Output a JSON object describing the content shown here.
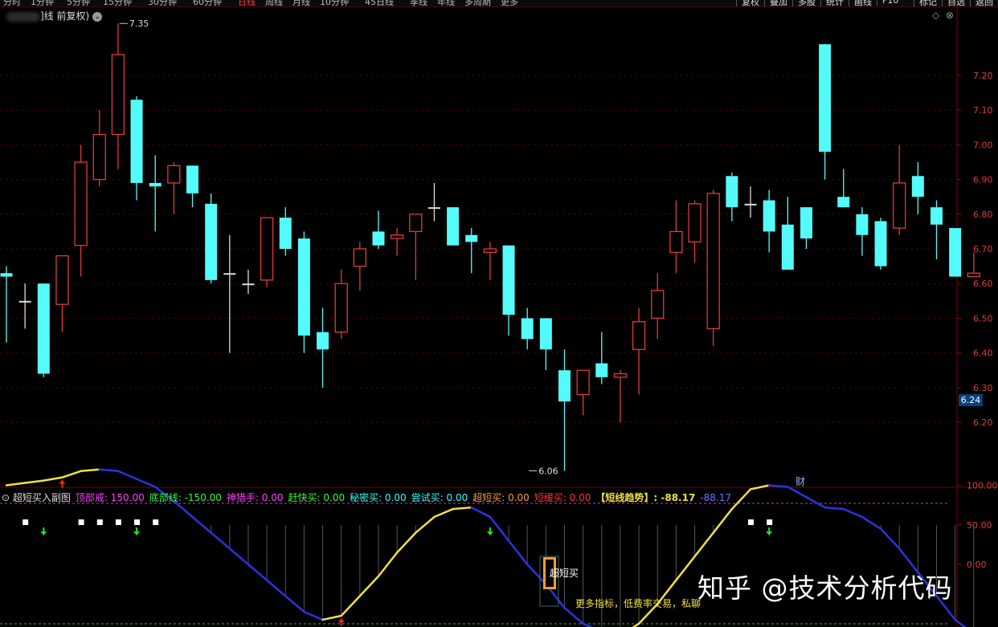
{
  "toolbar": {
    "periods": [
      "分时",
      "1分钟",
      "5分钟",
      "15分钟",
      "30分钟",
      "60分钟",
      "日线",
      "周线",
      "月线",
      "10分钟",
      "45日线",
      "季线",
      "年线",
      "多周期",
      "更多"
    ],
    "active_period": "日线",
    "buttons": [
      "复权",
      "叠加",
      "多股",
      "统计",
      "画线",
      "F10",
      "标记",
      "自选",
      "返回"
    ]
  },
  "chart_header": {
    "title": "日线 前复权",
    "label_text": "]线 前复权)"
  },
  "corner_controls": [
    "◇",
    "⊗"
  ],
  "price_tag": "6.24",
  "fin_marker": "财",
  "colors": {
    "up": "#e03b3b",
    "down": "#54fbfb",
    "doji": "#dddddd",
    "grid": "#6b0000",
    "trend_up": "#f0e040",
    "trend_down": "#2a33e0"
  },
  "chart_data": [
    {
      "type": "candlestick",
      "title": "",
      "ylim": [
        6.05,
        7.36
      ],
      "yticks": [
        "7.20",
        "7.10",
        "7.00",
        "6.90",
        "6.80",
        "6.70",
        "6.60",
        "6.50",
        "6.40",
        "6.30",
        "6.20"
      ],
      "annotations": [
        {
          "text": "7.35",
          "x_index": 6,
          "value": 7.35
        },
        {
          "text": "6.06",
          "x_index": 28,
          "value": 6.06
        }
      ],
      "ohlc": [
        {
          "o": 6.63,
          "h": 6.65,
          "l": 6.43,
          "c": 6.62
        },
        {
          "o": 6.55,
          "h": 6.6,
          "l": 6.47,
          "c": 6.55
        },
        {
          "o": 6.6,
          "h": 6.6,
          "l": 6.33,
          "c": 6.34
        },
        {
          "o": 6.54,
          "h": 6.68,
          "l": 6.46,
          "c": 6.68
        },
        {
          "o": 6.71,
          "h": 7.0,
          "l": 6.62,
          "c": 6.95
        },
        {
          "o": 6.9,
          "h": 7.1,
          "l": 6.88,
          "c": 7.03
        },
        {
          "o": 7.03,
          "h": 7.35,
          "l": 6.93,
          "c": 7.26
        },
        {
          "o": 7.13,
          "h": 7.14,
          "l": 6.84,
          "c": 6.89
        },
        {
          "o": 6.89,
          "h": 6.97,
          "l": 6.75,
          "c": 6.88
        },
        {
          "o": 6.89,
          "h": 6.95,
          "l": 6.8,
          "c": 6.94
        },
        {
          "o": 6.94,
          "h": 6.94,
          "l": 6.82,
          "c": 6.86
        },
        {
          "o": 6.83,
          "h": 6.86,
          "l": 6.6,
          "c": 6.61
        },
        {
          "o": 6.63,
          "h": 6.74,
          "l": 6.4,
          "c": 6.63
        },
        {
          "o": 6.6,
          "h": 6.64,
          "l": 6.57,
          "c": 6.6
        },
        {
          "o": 6.61,
          "h": 6.79,
          "l": 6.59,
          "c": 6.79
        },
        {
          "o": 6.79,
          "h": 6.82,
          "l": 6.68,
          "c": 6.7
        },
        {
          "o": 6.73,
          "h": 6.75,
          "l": 6.4,
          "c": 6.45
        },
        {
          "o": 6.46,
          "h": 6.53,
          "l": 6.3,
          "c": 6.41
        },
        {
          "o": 6.46,
          "h": 6.64,
          "l": 6.44,
          "c": 6.6
        },
        {
          "o": 6.65,
          "h": 6.72,
          "l": 6.58,
          "c": 6.7
        },
        {
          "o": 6.75,
          "h": 6.81,
          "l": 6.7,
          "c": 6.71
        },
        {
          "o": 6.73,
          "h": 6.76,
          "l": 6.68,
          "c": 6.74
        },
        {
          "o": 6.75,
          "h": 6.8,
          "l": 6.61,
          "c": 6.8
        },
        {
          "o": 6.82,
          "h": 6.89,
          "l": 6.78,
          "c": 6.82
        },
        {
          "o": 6.82,
          "h": 6.82,
          "l": 6.71,
          "c": 6.71
        },
        {
          "o": 6.74,
          "h": 6.76,
          "l": 6.63,
          "c": 6.72
        },
        {
          "o": 6.69,
          "h": 6.72,
          "l": 6.61,
          "c": 6.7
        },
        {
          "o": 6.71,
          "h": 6.71,
          "l": 6.45,
          "c": 6.51
        },
        {
          "o": 6.5,
          "h": 6.53,
          "l": 6.41,
          "c": 6.44
        },
        {
          "o": 6.5,
          "h": 6.5,
          "l": 6.35,
          "c": 6.41
        },
        {
          "o": 6.35,
          "h": 6.41,
          "l": 6.06,
          "c": 6.26
        },
        {
          "o": 6.28,
          "h": 6.35,
          "l": 6.22,
          "c": 6.35
        },
        {
          "o": 6.37,
          "h": 6.46,
          "l": 6.31,
          "c": 6.33
        },
        {
          "o": 6.33,
          "h": 6.35,
          "l": 6.2,
          "c": 6.34
        },
        {
          "o": 6.41,
          "h": 6.53,
          "l": 6.28,
          "c": 6.49
        },
        {
          "o": 6.5,
          "h": 6.63,
          "l": 6.44,
          "c": 6.58
        },
        {
          "o": 6.69,
          "h": 6.84,
          "l": 6.63,
          "c": 6.75
        },
        {
          "o": 6.72,
          "h": 6.84,
          "l": 6.66,
          "c": 6.83
        },
        {
          "o": 6.47,
          "h": 6.87,
          "l": 6.42,
          "c": 6.86
        },
        {
          "o": 6.91,
          "h": 6.92,
          "l": 6.78,
          "c": 6.82
        },
        {
          "o": 6.83,
          "h": 6.88,
          "l": 6.79,
          "c": 6.83
        },
        {
          "o": 6.84,
          "h": 6.87,
          "l": 6.69,
          "c": 6.75
        },
        {
          "o": 6.77,
          "h": 6.85,
          "l": 6.66,
          "c": 6.64
        },
        {
          "o": 6.82,
          "h": 6.82,
          "l": 6.7,
          "c": 6.73
        },
        {
          "o": 7.29,
          "h": 7.29,
          "l": 6.9,
          "c": 6.98
        },
        {
          "o": 6.85,
          "h": 6.93,
          "l": 6.82,
          "c": 6.82
        },
        {
          "o": 6.8,
          "h": 6.82,
          "l": 6.68,
          "c": 6.74
        },
        {
          "o": 6.78,
          "h": 6.79,
          "l": 6.64,
          "c": 6.65
        },
        {
          "o": 6.76,
          "h": 7.0,
          "l": 6.74,
          "c": 6.89
        },
        {
          "o": 6.91,
          "h": 6.95,
          "l": 6.8,
          "c": 6.85
        },
        {
          "o": 6.82,
          "h": 6.84,
          "l": 6.67,
          "c": 6.77
        },
        {
          "o": 6.76,
          "h": 6.76,
          "l": 6.62,
          "c": 6.62
        },
        {
          "o": 6.62,
          "h": 6.69,
          "l": 6.62,
          "c": 6.63
        }
      ]
    },
    {
      "type": "line",
      "title": "超短买入副图",
      "ylim": [
        -160,
        150
      ],
      "yticks": [
        "100.00",
        "50.00",
        "0.00"
      ],
      "legend": [
        {
          "label": "顶部戒",
          "value": "150.00",
          "color": "#ff40ff"
        },
        {
          "label": "底部线",
          "value": "-150.00",
          "color": "#33ff33"
        },
        {
          "label": "神猎手",
          "value": "0.00",
          "color": "#ff40ff"
        },
        {
          "label": "赶快买",
          "value": "0.00",
          "color": "#33ff33"
        },
        {
          "label": "秘密买",
          "value": "0.00",
          "color": "#33ffff"
        },
        {
          "label": "尝试买",
          "value": "0.00",
          "color": "#33ffff"
        },
        {
          "label": "超短买",
          "value": "0.00",
          "color": "#ff9933"
        },
        {
          "label": "短缓买",
          "value": "0.00",
          "color": "#ff3333"
        }
      ],
      "trend_label": "【短线趋势】",
      "trend_values": [
        "-88.17",
        "-88.17"
      ],
      "trend": [
        100,
        103,
        106,
        110,
        118,
        120,
        118,
        108,
        98,
        80,
        60,
        40,
        20,
        0,
        -20,
        -40,
        -60,
        -70,
        -65,
        -40,
        -15,
        15,
        40,
        60,
        70,
        72,
        60,
        30,
        0,
        -25,
        -55,
        -75,
        -85,
        -90,
        -75,
        -50,
        -20,
        10,
        40,
        70,
        95,
        100,
        98,
        85,
        72,
        70,
        60,
        45,
        20,
        -10,
        -40,
        -70,
        -88
      ],
      "signal_text": "超短买",
      "promo_text": "更多指标，低费率交易，私聊"
    }
  ],
  "watermark": "知乎 @技术分析代码"
}
